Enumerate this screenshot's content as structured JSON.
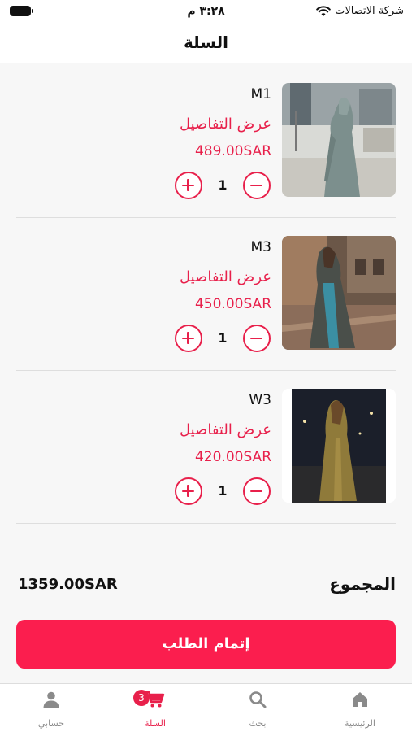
{
  "status_bar": {
    "carrier": "شركة الاتصالات",
    "time": "٣:٢٨ م"
  },
  "header": {
    "title": "السلة"
  },
  "cart": {
    "items": [
      {
        "name": "M1",
        "details_label": "عرض التفاصيل",
        "price": "489.00SAR",
        "quantity": "1"
      },
      {
        "name": "M3",
        "details_label": "عرض التفاصيل",
        "price": "450.00SAR",
        "quantity": "1"
      },
      {
        "name": "W3",
        "details_label": "عرض التفاصيل",
        "price": "420.00SAR",
        "quantity": "1"
      }
    ]
  },
  "summary": {
    "total_label": "المجموع",
    "total_value": "1359.00SAR",
    "checkout_label": "إتمام الطلب"
  },
  "tab_bar": {
    "home_label": "الرئيسية",
    "search_label": "بحث",
    "cart_label": "السلة",
    "cart_badge": "3",
    "account_label": "حسابي",
    "active_tab": "cart"
  },
  "colors": {
    "accent": "#e8204b",
    "button": "#fb1e4e"
  }
}
